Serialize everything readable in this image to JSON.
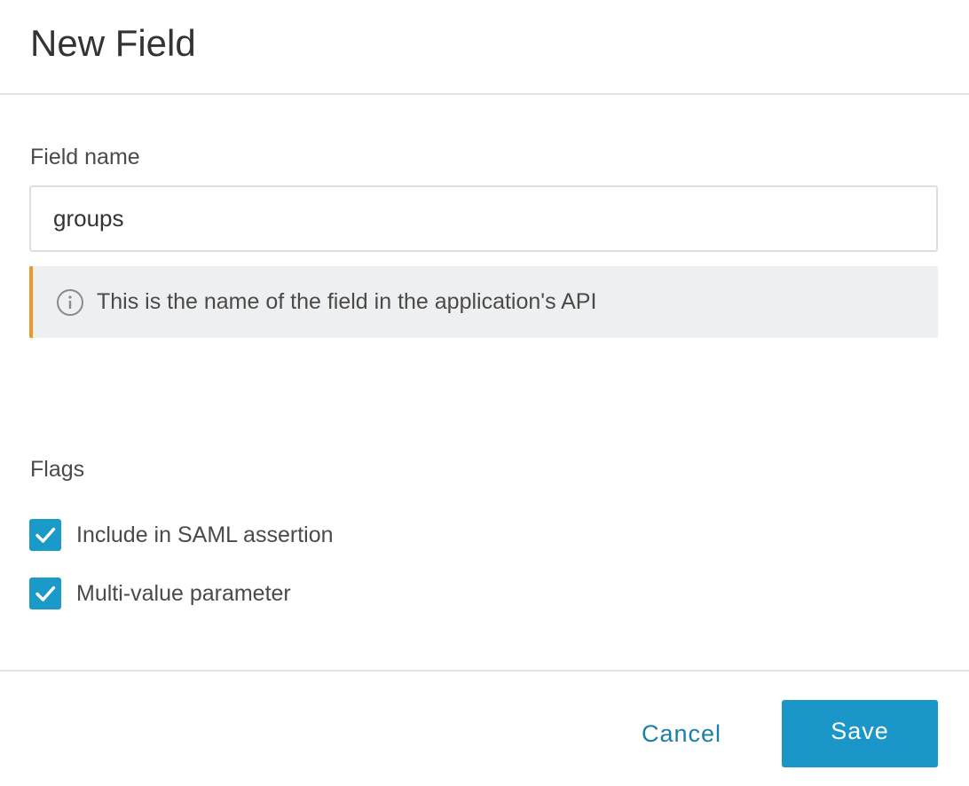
{
  "dialog": {
    "title": "New Field"
  },
  "field_name": {
    "label": "Field name",
    "value": "groups"
  },
  "info": {
    "icon": "info-circle-icon",
    "text": "This is the name of the field in the application's API",
    "accent_color": "#f0962a"
  },
  "flags": {
    "label": "Flags",
    "items": [
      {
        "label": "Include in SAML assertion",
        "checked": true,
        "icon": "checkmark-icon"
      },
      {
        "label": "Multi-value parameter",
        "checked": true,
        "icon": "checkmark-icon"
      }
    ],
    "checkbox_color": "#1a9ac9"
  },
  "footer": {
    "cancel_label": "Cancel",
    "save_label": "Save",
    "primary_color": "#1a96c8",
    "link_color": "#1a7fa8"
  }
}
